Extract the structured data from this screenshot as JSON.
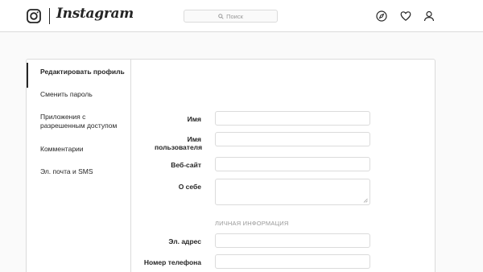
{
  "header": {
    "wordmark": "Instagram",
    "search": {
      "placeholder": "Поиск",
      "icon": "search-icon"
    },
    "nav_icons": [
      "explore-compass-icon",
      "activity-heart-icon",
      "profile-person-icon"
    ]
  },
  "sidebar": {
    "items": [
      {
        "label": "Редактировать профиль",
        "active": true
      },
      {
        "label": "Сменить пароль",
        "active": false
      },
      {
        "label": "Приложения с разрешенным доступом",
        "active": false
      },
      {
        "label": "Комментарии",
        "active": false
      },
      {
        "label": "Эл. почта и SMS",
        "active": false
      }
    ]
  },
  "form": {
    "name_label": "Имя",
    "username_label": "Имя пользователя",
    "website_label": "Веб-сайт",
    "bio_label": "О себе",
    "private_section": "ЛИЧНАЯ ИНФОРМАЦИЯ",
    "email_label": "Эл. адрес",
    "phone_label": "Номер телефона"
  },
  "colors": {
    "border": "#dbdbdb",
    "text": "#262626",
    "muted": "#999999",
    "background": "#fafafa"
  }
}
